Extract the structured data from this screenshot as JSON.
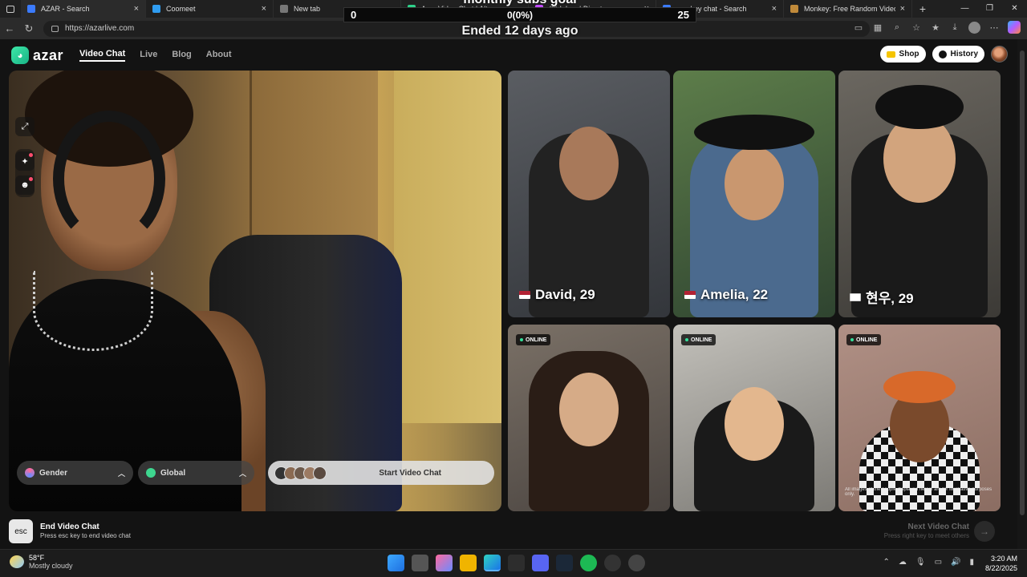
{
  "browser": {
    "tabs": [
      {
        "title": "AZAR - Search",
        "favicon_color": "#3b7bff",
        "active": true
      },
      {
        "title": "Coomeet",
        "favicon_color": "#2f9cf0"
      },
      {
        "title": "New tab",
        "favicon_color": "#777777"
      },
      {
        "title": "Azar Video Chat | Alter...",
        "favicon_color": "#2ed18a"
      },
      {
        "title": "(8) Inbox | Direct",
        "favicon_color": "#c34cff"
      },
      {
        "title": "monkey chat - Search",
        "favicon_color": "#3b7bff"
      },
      {
        "title": "Monkey: Free Random Video Cha",
        "favicon_color": "#c08a3a"
      }
    ],
    "url": "https://azarlive.com"
  },
  "stream_overlay": {
    "title": "monthly subs goal",
    "left_value": "0",
    "progress_text": "0(0%)",
    "right_value": "25",
    "ended_text": "Ended 12 days ago"
  },
  "nav": {
    "logo_text": "azar",
    "links": [
      "Video Chat",
      "Live",
      "Blog",
      "About"
    ],
    "shop_label": "Shop",
    "history_label": "History"
  },
  "controls": {
    "gender_label": "Gender",
    "global_label": "Global",
    "start_label": "Start Video Chat"
  },
  "profiles": [
    {
      "name": "David, 29",
      "flag": "us",
      "bg": "#4a4c50"
    },
    {
      "name": "Amelia, 22",
      "flag": "us",
      "bg": "#3f5a3a"
    },
    {
      "name": "현우, 29",
      "flag": "kr",
      "bg": "#5d5a55"
    },
    {
      "badge": "ONLINE",
      "bg": "#6b6258"
    },
    {
      "badge": "ONLINE",
      "bg": "#9d9a93"
    },
    {
      "badge": "ONLINE",
      "bg": "#a5887d",
      "fine_print": "All images of the people displayed herein are for illustrative purposes only."
    }
  ],
  "footer": {
    "esc_key": "esc",
    "end_title": "End Video Chat",
    "end_sub": "Press esc key to end video chat",
    "next_title": "Next Video Chat",
    "next_sub": "Press right key to meet others"
  },
  "taskbar": {
    "temperature": "58°F",
    "condition": "Mostly cloudy",
    "time": "3:20 AM",
    "date": "8/22/2025"
  }
}
